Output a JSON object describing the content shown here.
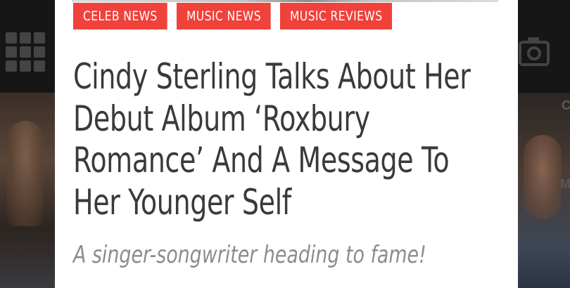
{
  "tags": [
    {
      "label": "CELEB NEWS"
    },
    {
      "label": "MUSIC NEWS"
    },
    {
      "label": "MUSIC REVIEWS"
    }
  ],
  "article": {
    "headline": "Cindy Sterling Talks About Her Debut Album ‘Roxbury Romance’ And A Message To Her Younger Self",
    "subtitle": "A singer-songwriter heading to fame!"
  },
  "background": {
    "edge_letters": [
      "C",
      "M"
    ]
  },
  "colors": {
    "tag_background": "#f0413b",
    "headline_text": "#3a3a3a",
    "subtitle_text": "#8c8c8c",
    "card_background": "#ffffff",
    "backdrop": "#161616"
  },
  "icons": [
    "grid-icon",
    "camera-icon"
  ]
}
